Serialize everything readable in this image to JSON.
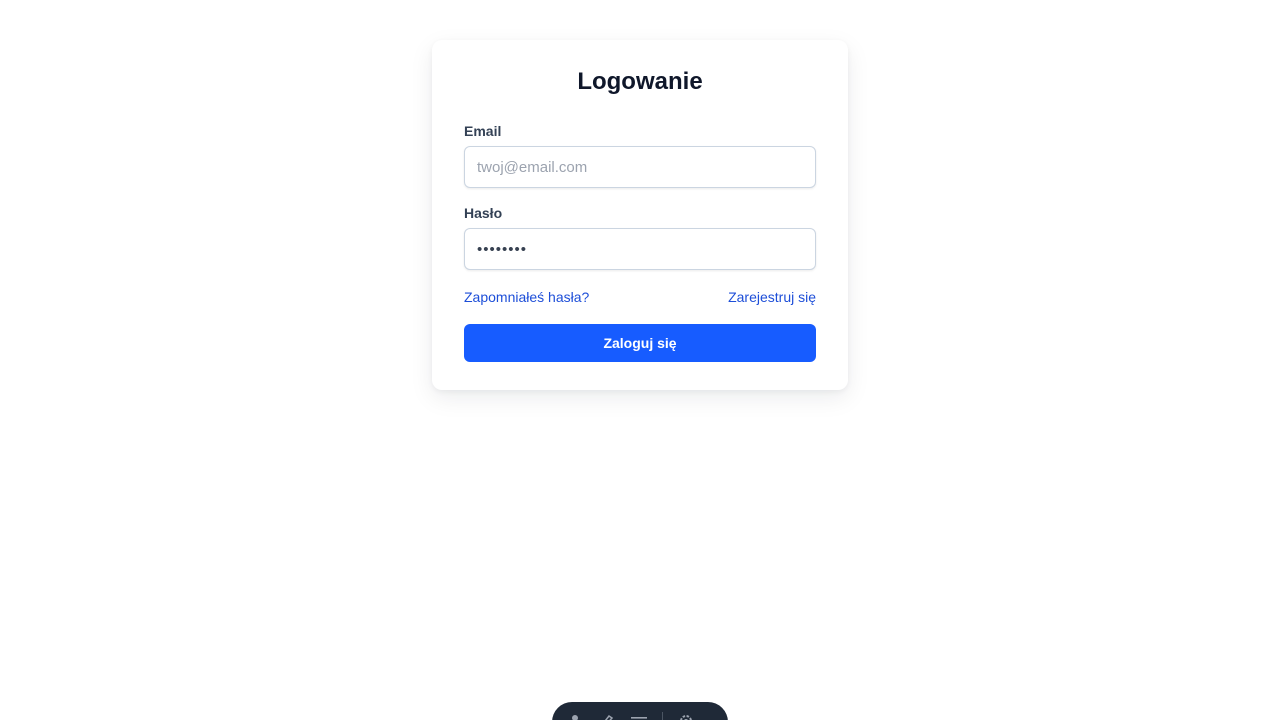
{
  "login": {
    "title": "Logowanie",
    "email_label": "Email",
    "email_placeholder": "twoj@email.com",
    "email_value": "",
    "password_label": "Hasło",
    "password_value": "••••••••",
    "forgot_link": "Zapomniałeś hasła?",
    "register_link": "Zarejestruj się",
    "submit_label": "Zaloguj się"
  },
  "colors": {
    "primary": "#175cff",
    "link": "#1d4ed8",
    "title": "#0f172a",
    "dock_bg": "#1f2937"
  },
  "dock": {
    "icons": [
      "user-icon",
      "brush-icon",
      "menu-icon",
      "gear-icon"
    ]
  }
}
